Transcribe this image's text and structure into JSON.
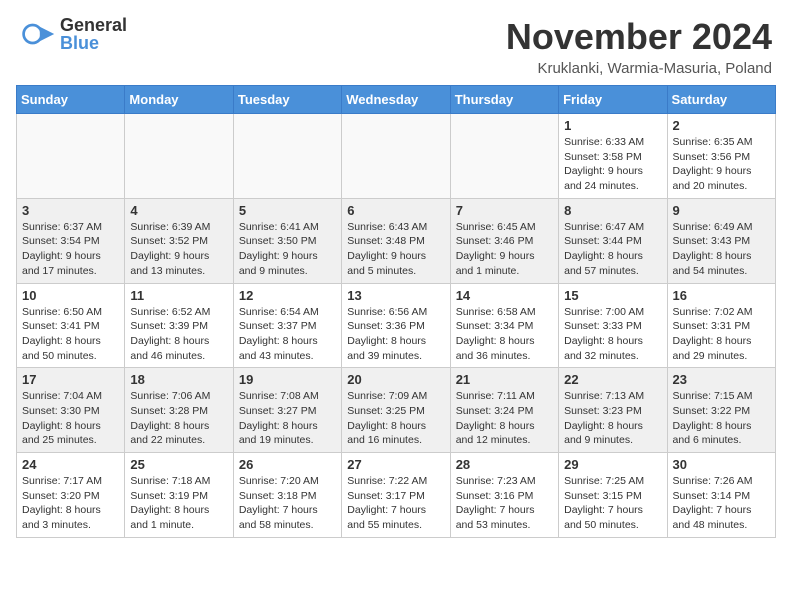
{
  "logo": {
    "general": "General",
    "blue": "Blue"
  },
  "header": {
    "month": "November 2024",
    "location": "Kruklanki, Warmia-Masuria, Poland"
  },
  "weekdays": [
    "Sunday",
    "Monday",
    "Tuesday",
    "Wednesday",
    "Thursday",
    "Friday",
    "Saturday"
  ],
  "weeks": [
    [
      {
        "day": "",
        "info": ""
      },
      {
        "day": "",
        "info": ""
      },
      {
        "day": "",
        "info": ""
      },
      {
        "day": "",
        "info": ""
      },
      {
        "day": "",
        "info": ""
      },
      {
        "day": "1",
        "info": "Sunrise: 6:33 AM\nSunset: 3:58 PM\nDaylight: 9 hours and 24 minutes."
      },
      {
        "day": "2",
        "info": "Sunrise: 6:35 AM\nSunset: 3:56 PM\nDaylight: 9 hours and 20 minutes."
      }
    ],
    [
      {
        "day": "3",
        "info": "Sunrise: 6:37 AM\nSunset: 3:54 PM\nDaylight: 9 hours and 17 minutes."
      },
      {
        "day": "4",
        "info": "Sunrise: 6:39 AM\nSunset: 3:52 PM\nDaylight: 9 hours and 13 minutes."
      },
      {
        "day": "5",
        "info": "Sunrise: 6:41 AM\nSunset: 3:50 PM\nDaylight: 9 hours and 9 minutes."
      },
      {
        "day": "6",
        "info": "Sunrise: 6:43 AM\nSunset: 3:48 PM\nDaylight: 9 hours and 5 minutes."
      },
      {
        "day": "7",
        "info": "Sunrise: 6:45 AM\nSunset: 3:46 PM\nDaylight: 9 hours and 1 minute."
      },
      {
        "day": "8",
        "info": "Sunrise: 6:47 AM\nSunset: 3:44 PM\nDaylight: 8 hours and 57 minutes."
      },
      {
        "day": "9",
        "info": "Sunrise: 6:49 AM\nSunset: 3:43 PM\nDaylight: 8 hours and 54 minutes."
      }
    ],
    [
      {
        "day": "10",
        "info": "Sunrise: 6:50 AM\nSunset: 3:41 PM\nDaylight: 8 hours and 50 minutes."
      },
      {
        "day": "11",
        "info": "Sunrise: 6:52 AM\nSunset: 3:39 PM\nDaylight: 8 hours and 46 minutes."
      },
      {
        "day": "12",
        "info": "Sunrise: 6:54 AM\nSunset: 3:37 PM\nDaylight: 8 hours and 43 minutes."
      },
      {
        "day": "13",
        "info": "Sunrise: 6:56 AM\nSunset: 3:36 PM\nDaylight: 8 hours and 39 minutes."
      },
      {
        "day": "14",
        "info": "Sunrise: 6:58 AM\nSunset: 3:34 PM\nDaylight: 8 hours and 36 minutes."
      },
      {
        "day": "15",
        "info": "Sunrise: 7:00 AM\nSunset: 3:33 PM\nDaylight: 8 hours and 32 minutes."
      },
      {
        "day": "16",
        "info": "Sunrise: 7:02 AM\nSunset: 3:31 PM\nDaylight: 8 hours and 29 minutes."
      }
    ],
    [
      {
        "day": "17",
        "info": "Sunrise: 7:04 AM\nSunset: 3:30 PM\nDaylight: 8 hours and 25 minutes."
      },
      {
        "day": "18",
        "info": "Sunrise: 7:06 AM\nSunset: 3:28 PM\nDaylight: 8 hours and 22 minutes."
      },
      {
        "day": "19",
        "info": "Sunrise: 7:08 AM\nSunset: 3:27 PM\nDaylight: 8 hours and 19 minutes."
      },
      {
        "day": "20",
        "info": "Sunrise: 7:09 AM\nSunset: 3:25 PM\nDaylight: 8 hours and 16 minutes."
      },
      {
        "day": "21",
        "info": "Sunrise: 7:11 AM\nSunset: 3:24 PM\nDaylight: 8 hours and 12 minutes."
      },
      {
        "day": "22",
        "info": "Sunrise: 7:13 AM\nSunset: 3:23 PM\nDaylight: 8 hours and 9 minutes."
      },
      {
        "day": "23",
        "info": "Sunrise: 7:15 AM\nSunset: 3:22 PM\nDaylight: 8 hours and 6 minutes."
      }
    ],
    [
      {
        "day": "24",
        "info": "Sunrise: 7:17 AM\nSunset: 3:20 PM\nDaylight: 8 hours and 3 minutes."
      },
      {
        "day": "25",
        "info": "Sunrise: 7:18 AM\nSunset: 3:19 PM\nDaylight: 8 hours and 1 minute."
      },
      {
        "day": "26",
        "info": "Sunrise: 7:20 AM\nSunset: 3:18 PM\nDaylight: 7 hours and 58 minutes."
      },
      {
        "day": "27",
        "info": "Sunrise: 7:22 AM\nSunset: 3:17 PM\nDaylight: 7 hours and 55 minutes."
      },
      {
        "day": "28",
        "info": "Sunrise: 7:23 AM\nSunset: 3:16 PM\nDaylight: 7 hours and 53 minutes."
      },
      {
        "day": "29",
        "info": "Sunrise: 7:25 AM\nSunset: 3:15 PM\nDaylight: 7 hours and 50 minutes."
      },
      {
        "day": "30",
        "info": "Sunrise: 7:26 AM\nSunset: 3:14 PM\nDaylight: 7 hours and 48 minutes."
      }
    ]
  ]
}
